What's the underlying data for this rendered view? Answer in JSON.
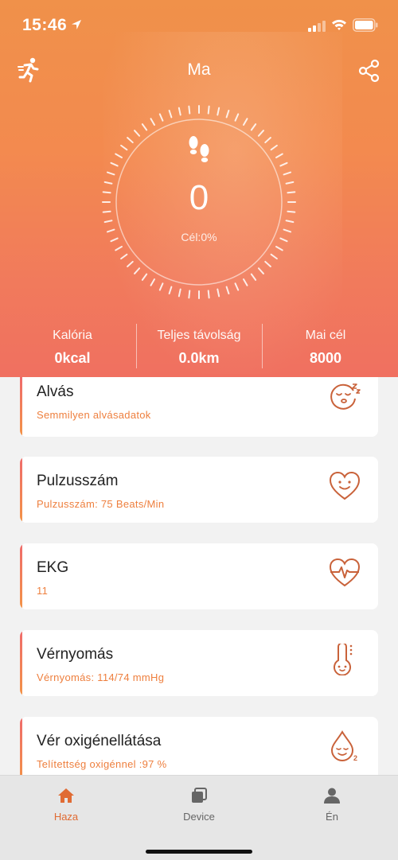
{
  "status": {
    "time": "15:46"
  },
  "header": {
    "title": "Ma"
  },
  "steps": {
    "count": "0",
    "goal_label": "Cél:0%",
    "progress_fraction": 0
  },
  "stats": [
    {
      "label": "Kalória",
      "value": "0kcal"
    },
    {
      "label": "Teljes távolság",
      "value": "0.0km"
    },
    {
      "label": "Mai cél",
      "value": "8000"
    }
  ],
  "cards": [
    {
      "title": "Alvás",
      "subtitle": "Semmilyen alvásadatok",
      "icon": "sleep-face-icon"
    },
    {
      "title": "Pulzusszám",
      "subtitle": "Pulzusszám: 75 Beats/Min",
      "icon": "heart-smile-icon"
    },
    {
      "title": "EKG",
      "subtitle": "11",
      "icon": "heart-ecg-icon"
    },
    {
      "title": "Vérnyomás",
      "subtitle": "Vérnyomás: 114/74 mmHg",
      "icon": "thermometer-face-icon"
    },
    {
      "title": "Vér oxigénellátása",
      "subtitle": "Telítettség oxigénnel :97 %",
      "icon": "drop-o2-icon"
    }
  ],
  "tabs": [
    {
      "label": "Haza",
      "icon": "home-icon",
      "active": true
    },
    {
      "label": "Device",
      "icon": "device-icon",
      "active": false
    },
    {
      "label": "Én",
      "icon": "person-icon",
      "active": false
    }
  ],
  "colors": {
    "accent": "#e06b33",
    "card_subtitle": "#ee7f3e",
    "icon_stroke": "#c9623a",
    "header_top": "#f0914a",
    "header_bottom": "#f07060"
  }
}
